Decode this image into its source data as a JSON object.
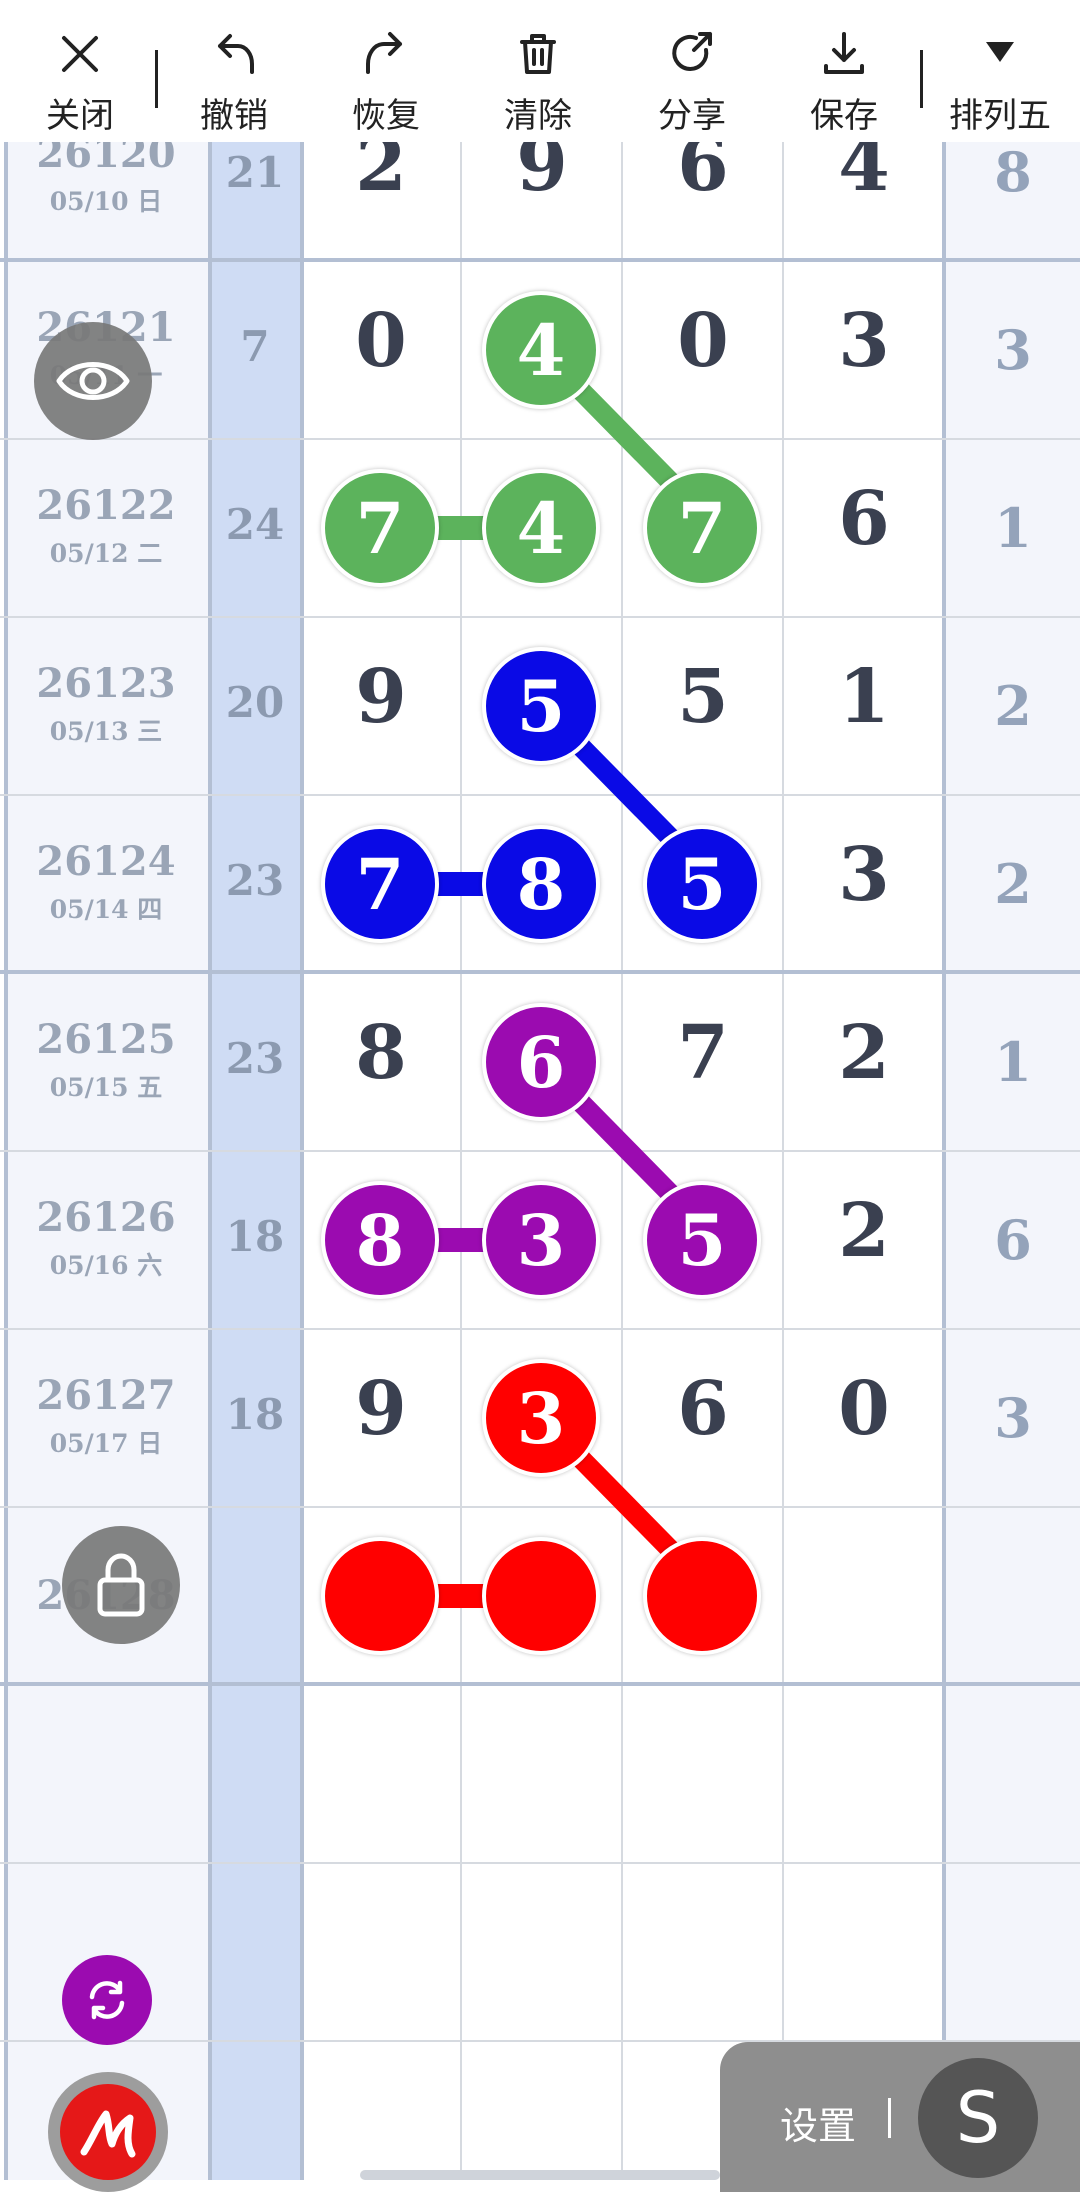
{
  "toolbar": {
    "close": "关闭",
    "undo": "撤销",
    "redo": "恢复",
    "clear": "清除",
    "share": "分享",
    "save": "保存",
    "lottery": "排列五"
  },
  "rows": [
    {
      "issue": "26120",
      "date": "05/10 日",
      "sum": "21",
      "d": [
        "2",
        "9",
        "6",
        "4"
      ],
      "sp": "8"
    },
    {
      "issue": "26121",
      "date": "05/11 一",
      "sum": "7",
      "d": [
        "0",
        "4",
        "0",
        "3"
      ],
      "sp": "3"
    },
    {
      "issue": "26122",
      "date": "05/12 二",
      "sum": "24",
      "d": [
        "7",
        "4",
        "7",
        "6"
      ],
      "sp": "1"
    },
    {
      "issue": "26123",
      "date": "05/13 三",
      "sum": "20",
      "d": [
        "9",
        "5",
        "5",
        "1"
      ],
      "sp": "2"
    },
    {
      "issue": "26124",
      "date": "05/14 四",
      "sum": "23",
      "d": [
        "7",
        "8",
        "5",
        "3"
      ],
      "sp": "2"
    },
    {
      "issue": "26125",
      "date": "05/15 五",
      "sum": "23",
      "d": [
        "8",
        "6",
        "7",
        "2"
      ],
      "sp": "1"
    },
    {
      "issue": "26126",
      "date": "05/16 六",
      "sum": "18",
      "d": [
        "8",
        "3",
        "5",
        "2"
      ],
      "sp": "6"
    },
    {
      "issue": "26127",
      "date": "05/17 日",
      "sum": "18",
      "d": [
        "9",
        "3",
        "6",
        "0"
      ],
      "sp": "3"
    },
    {
      "issue": "26128",
      "date": "",
      "sum": "",
      "d": [
        "",
        "",
        "",
        ""
      ],
      "sp": ""
    }
  ],
  "markers": {
    "green": "#5cb35c",
    "blue": "#0a0ae6",
    "purple": "#9b0bb0",
    "red": "#ff0000"
  },
  "settings": {
    "label": "设置",
    "logo": "S"
  }
}
